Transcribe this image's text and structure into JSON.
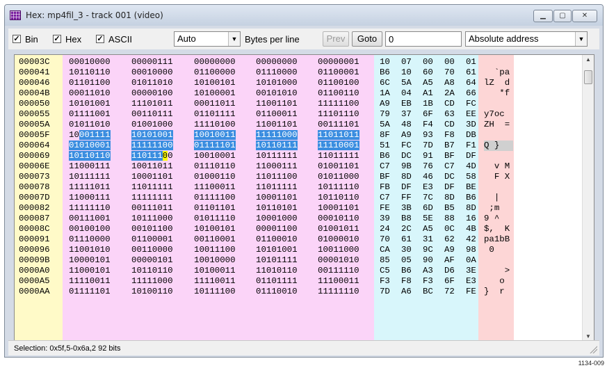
{
  "window": {
    "title": "Hex: mp4fil_3 - track 001 (video)"
  },
  "toolbar": {
    "bin_label": "Bin",
    "hex_label": "Hex",
    "ascii_label": "ASCII",
    "mode_value": "Auto",
    "bytes_per_line_label": "Bytes per line",
    "prev_label": "Prev",
    "goto_label": "Goto",
    "goto_value": "0",
    "address_mode_value": "Absolute address"
  },
  "columns_colors": {
    "address_bg": "#fffac8",
    "binary_bg": "#fbd4f8",
    "hex_bg": "#d8f6fb",
    "ascii_bg": "#fdd6d6",
    "selection": "#3a8de0",
    "cursor": "#ffff00"
  },
  "rows": [
    {
      "addr": "00003C",
      "bin": [
        "00010000",
        "00000111",
        "00000000",
        "00000000",
        "00000001"
      ],
      "hex": [
        "10",
        "07",
        "00",
        "00",
        "01"
      ],
      "ascii": ""
    },
    {
      "addr": "000041",
      "bin": [
        "10110110",
        "00010000",
        "01100000",
        "01110000",
        "01100001"
      ],
      "hex": [
        "B6",
        "10",
        "60",
        "70",
        "61"
      ],
      "ascii": "  `pa"
    },
    {
      "addr": "000046",
      "bin": [
        "01101100",
        "01011010",
        "10100101",
        "10101000",
        "01100100"
      ],
      "hex": [
        "6C",
        "5A",
        "A5",
        "A8",
        "64"
      ],
      "ascii": "lZ  d"
    },
    {
      "addr": "00004B",
      "bin": [
        "00011010",
        "00000100",
        "10100001",
        "00101010",
        "01100110"
      ],
      "hex": [
        "1A",
        "04",
        "A1",
        "2A",
        "66"
      ],
      "ascii": "   *f"
    },
    {
      "addr": "000050",
      "bin": [
        "10101001",
        "11101011",
        "00011011",
        "11001101",
        "11111100"
      ],
      "hex": [
        "A9",
        "EB",
        "1B",
        "CD",
        "FC"
      ],
      "ascii": ""
    },
    {
      "addr": "000055",
      "bin": [
        "01111001",
        "00110111",
        "01101111",
        "01100011",
        "11101110"
      ],
      "hex": [
        "79",
        "37",
        "6F",
        "63",
        "EE"
      ],
      "ascii": "y7oc"
    },
    {
      "addr": "00005A",
      "bin": [
        "01011010",
        "01001000",
        "11110100",
        "11001101",
        "00111101"
      ],
      "hex": [
        "5A",
        "48",
        "F4",
        "CD",
        "3D"
      ],
      "ascii": "ZH  ="
    },
    {
      "addr": "00005F",
      "bin": [
        "10001111",
        "10101001",
        "10010011",
        "11111000",
        "11011011"
      ],
      "hex": [
        "8F",
        "A9",
        "93",
        "F8",
        "DB"
      ],
      "ascii": ""
    },
    {
      "addr": "000064",
      "bin": [
        "01010001",
        "11111100",
        "01111101",
        "10110111",
        "11110001"
      ],
      "hex": [
        "51",
        "FC",
        "7D",
        "B7",
        "F1"
      ],
      "ascii": "Q }"
    },
    {
      "addr": "000069",
      "bin": [
        "10110110",
        "11011100",
        "10010001",
        "10111111",
        "11011111"
      ],
      "hex": [
        "B6",
        "DC",
        "91",
        "BF",
        "DF"
      ],
      "ascii": ""
    },
    {
      "addr": "00006E",
      "bin": [
        "11000111",
        "10011011",
        "01110110",
        "11000111",
        "01001101"
      ],
      "hex": [
        "C7",
        "9B",
        "76",
        "C7",
        "4D"
      ],
      "ascii": "  v M"
    },
    {
      "addr": "000073",
      "bin": [
        "10111111",
        "10001101",
        "01000110",
        "11011100",
        "01011000"
      ],
      "hex": [
        "BF",
        "8D",
        "46",
        "DC",
        "58"
      ],
      "ascii": "  F X"
    },
    {
      "addr": "000078",
      "bin": [
        "11111011",
        "11011111",
        "11100011",
        "11011111",
        "10111110"
      ],
      "hex": [
        "FB",
        "DF",
        "E3",
        "DF",
        "BE"
      ],
      "ascii": ""
    },
    {
      "addr": "00007D",
      "bin": [
        "11000111",
        "11111111",
        "01111100",
        "10001101",
        "10110110"
      ],
      "hex": [
        "C7",
        "FF",
        "7C",
        "8D",
        "B6"
      ],
      "ascii": "  |"
    },
    {
      "addr": "000082",
      "bin": [
        "11111110",
        "00111011",
        "01101101",
        "10110101",
        "10001101"
      ],
      "hex": [
        "FE",
        "3B",
        "6D",
        "B5",
        "8D"
      ],
      "ascii": " ;m"
    },
    {
      "addr": "000087",
      "bin": [
        "00111001",
        "10111000",
        "01011110",
        "10001000",
        "00010110"
      ],
      "hex": [
        "39",
        "B8",
        "5E",
        "88",
        "16"
      ],
      "ascii": "9 ^"
    },
    {
      "addr": "00008C",
      "bin": [
        "00100100",
        "00101100",
        "10100101",
        "00001100",
        "01001011"
      ],
      "hex": [
        "24",
        "2C",
        "A5",
        "0C",
        "4B"
      ],
      "ascii": "$,  K"
    },
    {
      "addr": "000091",
      "bin": [
        "01110000",
        "01100001",
        "00110001",
        "01100010",
        "01000010"
      ],
      "hex": [
        "70",
        "61",
        "31",
        "62",
        "42"
      ],
      "ascii": "pa1bB"
    },
    {
      "addr": "000096",
      "bin": [
        "11001010",
        "00110000",
        "10011100",
        "10101001",
        "10011000"
      ],
      "hex": [
        "CA",
        "30",
        "9C",
        "A9",
        "98"
      ],
      "ascii": " 0"
    },
    {
      "addr": "00009B",
      "bin": [
        "10000101",
        "00000101",
        "10010000",
        "10101111",
        "00001010"
      ],
      "hex": [
        "85",
        "05",
        "90",
        "AF",
        "0A"
      ],
      "ascii": ""
    },
    {
      "addr": "0000A0",
      "bin": [
        "11000101",
        "10110110",
        "10100011",
        "11010110",
        "00111110"
      ],
      "hex": [
        "C5",
        "B6",
        "A3",
        "D6",
        "3E"
      ],
      "ascii": "    >"
    },
    {
      "addr": "0000A5",
      "bin": [
        "11110011",
        "11111000",
        "11110011",
        "01101111",
        "11100011"
      ],
      "hex": [
        "F3",
        "F8",
        "F3",
        "6F",
        "E3"
      ],
      "ascii": "   o"
    },
    {
      "addr": "0000AA",
      "bin": [
        "01111101",
        "10100110",
        "10111100",
        "01110010",
        "11111110"
      ],
      "hex": [
        "7D",
        "A6",
        "BC",
        "72",
        "FE"
      ],
      "ascii": "}  r"
    }
  ],
  "selection": {
    "first_row": 7,
    "first_bit": 2,
    "last_row": 9,
    "last_bit": 13
  },
  "status": {
    "text": "Selection: 0x5f,5-0x6a,2 92 bits"
  },
  "figure_id": "1134-009"
}
